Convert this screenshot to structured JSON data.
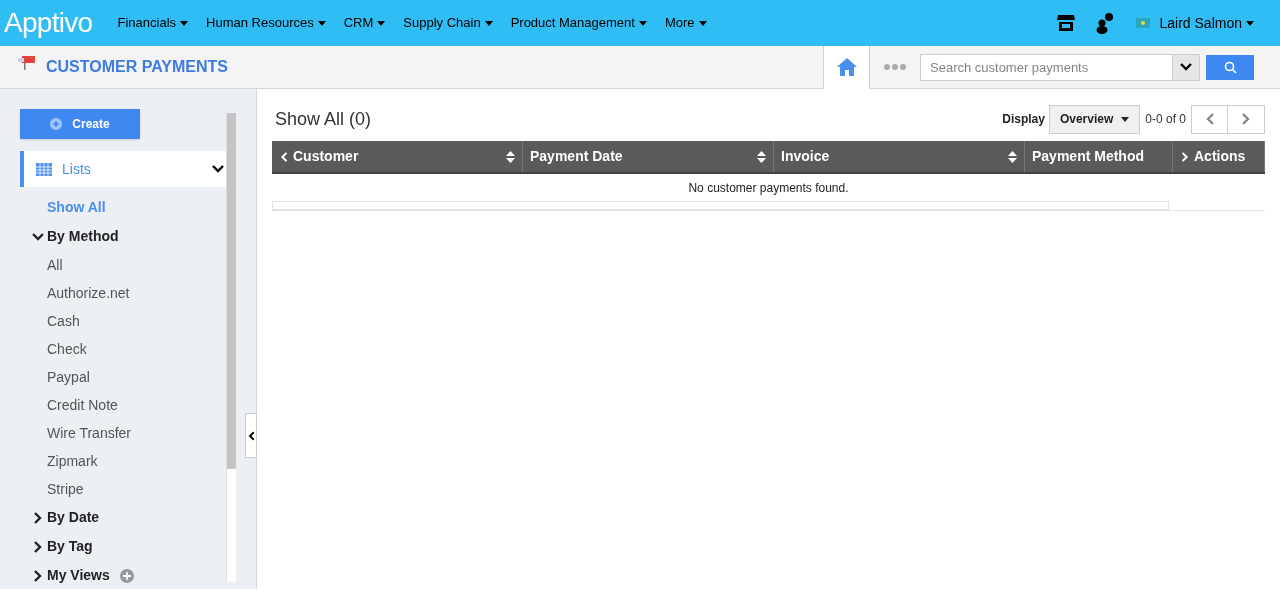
{
  "topbar": {
    "logo": "Apptivo",
    "menus": [
      {
        "label": "Financials"
      },
      {
        "label": "Human Resources"
      },
      {
        "label": "CRM"
      },
      {
        "label": "Supply Chain"
      },
      {
        "label": "Product Management"
      },
      {
        "label": "More"
      }
    ],
    "user": "Laird Salmon"
  },
  "header": {
    "title": "CUSTOMER PAYMENTS",
    "search": {
      "placeholder": "Search customer payments"
    }
  },
  "sidebar": {
    "create": "Create",
    "lists_label": "Lists",
    "lists_expanded": true,
    "items": [
      {
        "kind": "link",
        "label": "Show All",
        "selected": true
      },
      {
        "kind": "group",
        "label": "By Method",
        "expanded": true,
        "children": [
          {
            "label": "All",
            "selected": false
          },
          {
            "label": "Authorize.net",
            "selected": false
          },
          {
            "label": "Cash",
            "selected": false
          },
          {
            "label": "Check",
            "selected": false
          },
          {
            "label": "Paypal",
            "selected": false
          },
          {
            "label": "Credit Note",
            "selected": false
          },
          {
            "label": "Wire Transfer",
            "selected": false
          },
          {
            "label": "Zipmark",
            "selected": false
          },
          {
            "label": "Stripe",
            "selected": false
          }
        ]
      },
      {
        "kind": "group",
        "label": "By Date",
        "expanded": false
      },
      {
        "kind": "group",
        "label": "By Tag",
        "expanded": false
      },
      {
        "kind": "group",
        "label": "My Views",
        "expanded": false,
        "addable": true
      }
    ]
  },
  "main": {
    "title": "Show All (0)",
    "display_label": "Display",
    "display_value": "Overview",
    "range": "0-0 of 0",
    "table": {
      "columns": [
        {
          "label": "Customer",
          "collapse_arrow": true,
          "sortable": true
        },
        {
          "label": "Payment Date",
          "sortable": true
        },
        {
          "label": "Invoice",
          "sortable": true
        },
        {
          "label": "Payment Method",
          "sortable": false
        },
        {
          "label": "Actions",
          "expand_arrow": true,
          "sortable": false
        }
      ],
      "empty_message": "No customer payments found."
    }
  }
}
